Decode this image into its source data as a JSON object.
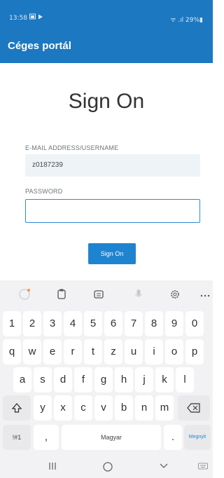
{
  "status_bar": {
    "time": "13:58",
    "right": "ᯤ .ıl 29%▮"
  },
  "app_bar": {
    "title": "Céges portál"
  },
  "form": {
    "heading": "Sign On",
    "email_label": "E-MAIL ADDRESS/USERNAME",
    "email_value": "z0187239",
    "password_label": "PASSWORD",
    "password_value": "",
    "submit_label": "Sign On"
  },
  "keyboard": {
    "row_numbers": [
      "1",
      "2",
      "3",
      "4",
      "5",
      "6",
      "7",
      "8",
      "9",
      "0"
    ],
    "row_q": [
      "q",
      "w",
      "e",
      "r",
      "t",
      "z",
      "u",
      "i",
      "o",
      "p"
    ],
    "row_a": [
      "a",
      "s",
      "d",
      "f",
      "g",
      "h",
      "j",
      "k",
      "l"
    ],
    "row_y": [
      "y",
      "x",
      "c",
      "v",
      "b",
      "n",
      "m"
    ],
    "symbols_label": "!#1",
    "comma_label": ",",
    "space_label": "Magyar",
    "period_label": ".",
    "enter_label": "Megnyit"
  },
  "colors": {
    "primary": "#1c78c0",
    "button": "#1f84cf"
  }
}
